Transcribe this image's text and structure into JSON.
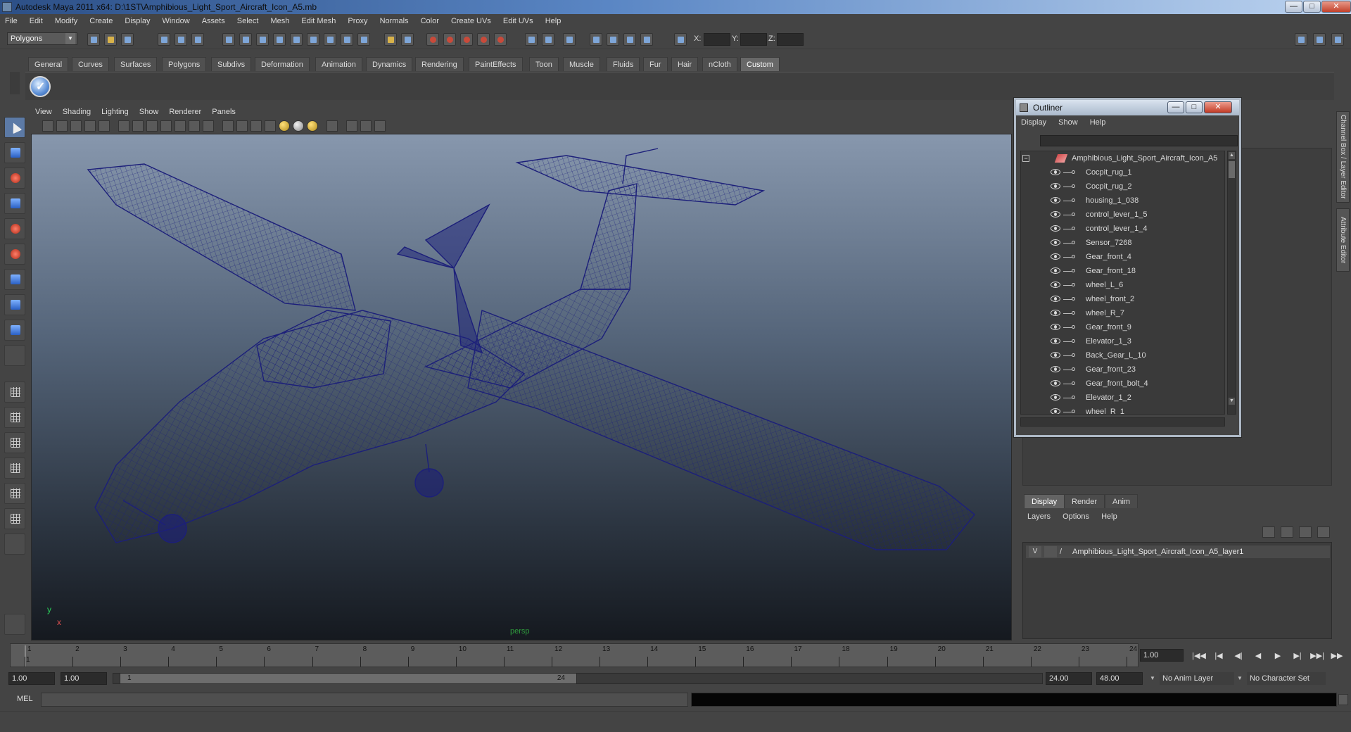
{
  "window": {
    "title": "Autodesk Maya 2011 x64: D:\\1ST\\Amphibious_Light_Sport_Aircraft_Icon_A5.mb",
    "minimize": "—",
    "maximize": "□",
    "close": "✕"
  },
  "menubar": [
    "File",
    "Edit",
    "Modify",
    "Create",
    "Display",
    "Window",
    "Assets",
    "Select",
    "Mesh",
    "Edit Mesh",
    "Proxy",
    "Normals",
    "Color",
    "Create UVs",
    "Edit UVs",
    "Help"
  ],
  "status": {
    "mode": "Polygons",
    "x_label": "X:",
    "y_label": "Y:",
    "z_label": "Z:"
  },
  "shelf": {
    "tabs": [
      "General",
      "Curves",
      "Surfaces",
      "Polygons",
      "Subdivs",
      "Deformation",
      "Animation",
      "Dynamics",
      "Rendering",
      "PaintEffects",
      "Toon",
      "Muscle",
      "Fluids",
      "Fur",
      "Hair",
      "nCloth",
      "Custom"
    ],
    "active": "Custom"
  },
  "viewport": {
    "menu": [
      "View",
      "Shading",
      "Lighting",
      "Show",
      "Renderer",
      "Panels"
    ],
    "camera_label": "persp",
    "axis_y": "y",
    "axis_x": "x",
    "wire_color": "#1c1f7a"
  },
  "outliner": {
    "title": "Outliner",
    "min": "—",
    "max": "□",
    "close": "✕",
    "menu": [
      "Display",
      "Show",
      "Help"
    ],
    "root": "Amphibious_Light_Sport_Aircraft_Icon_A5",
    "items": [
      "Cocpit_rug_1",
      "Cocpit_rug_2",
      "housing_1_038",
      "control_lever_1_5",
      "control_lever_1_4",
      "Sensor_7268",
      "Gear_front_4",
      "Gear_front_18",
      "wheel_L_6",
      "wheel_front_2",
      "wheel_R_7",
      "Gear_front_9",
      "Elevator_1_3",
      "Back_Gear_L_10",
      "Gear_front_23",
      "Gear_front_bolt_4",
      "Elevator_1_2",
      "wheel_R_1"
    ]
  },
  "channel_box": {
    "vertical_tabs": [
      "Channel Box / Layer Editor",
      "Attribute Editor"
    ]
  },
  "layer_editor": {
    "tabs": [
      "Display",
      "Render",
      "Anim"
    ],
    "active": "Display",
    "menu": [
      "Layers",
      "Options",
      "Help"
    ],
    "layer": {
      "visible": "V",
      "slash": "/",
      "name": "Amphibious_Light_Sport_Aircraft_Icon_A5_layer1"
    }
  },
  "timeline": {
    "ticks": [
      "1",
      "2",
      "3",
      "4",
      "5",
      "6",
      "7",
      "8",
      "9",
      "10",
      "11",
      "12",
      "13",
      "14",
      "15",
      "16",
      "17",
      "18",
      "19",
      "20",
      "21",
      "22",
      "23",
      "24"
    ],
    "current_frame_marker": "1",
    "current_time": "1.00",
    "playback": [
      "|◀◀",
      "|◀",
      "◀|",
      "◀",
      "▶",
      "▶|",
      "▶▶|",
      "▶▶"
    ]
  },
  "range": {
    "start": "1.00",
    "playback_start": "1.00",
    "range_start": "1",
    "range_end": "24",
    "playback_end": "24.00",
    "end": "48.00",
    "anim_layer": "No Anim Layer",
    "character_set": "No Character Set"
  },
  "command": {
    "label": "MEL"
  }
}
